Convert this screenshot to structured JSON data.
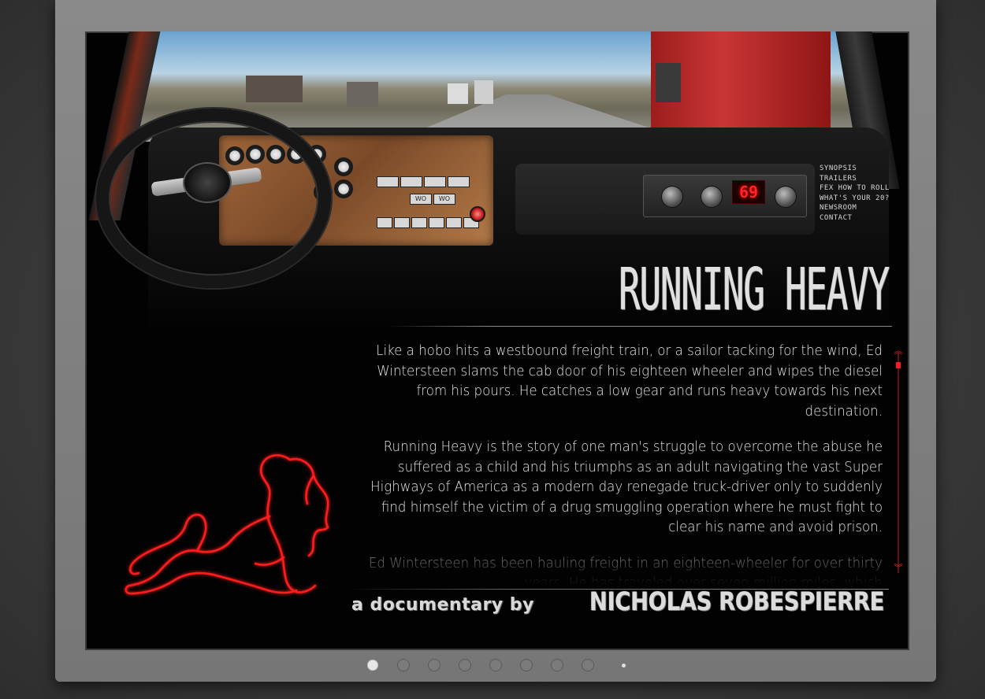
{
  "nav": {
    "items": [
      "SYNOPSIS",
      "TRAILERS",
      "FEX HOW TO ROLL",
      "WHAT'S YOUR 20?",
      "NEWSROOM",
      "CONTACT"
    ]
  },
  "header": {
    "title": "RUNNING HEAVY"
  },
  "synopsis": {
    "paragraphs": [
      "Like a hobo hits a westbound freight train, or a sailor tacking for the wind, Ed Wintersteen slams the cab door of his eighteen wheeler and wipes the diesel from his pours.  He catches a low gear and runs heavy towards his next destination.",
      "Running Heavy is the story of one man's struggle to overcome the abuse he suffered as a child and his triumphs as an adult navigating the vast Super Highways of America as a modern day renegade truck-driver only to suddenly find himself the victim of a drug smuggling operation where he must fight to clear his name and avoid prison.",
      "Ed Wintersteen has been hauling freight in an eighteen-wheeler for over thirty years. He has traveled over seven million miles, which"
    ]
  },
  "dashboard": {
    "radio_display": "69",
    "switch_labels": [
      "WO",
      "WO"
    ]
  },
  "credit": {
    "prefix": "a documentary by",
    "name": "NICHOLAS ROBESPIERRE"
  },
  "scroll": {
    "up_icon": "double-chevron-up-icon",
    "down_icon": "double-chevron-down-icon",
    "up_glyph": "︽",
    "down_glyph": "︾"
  },
  "pagination": {
    "total": 8,
    "active_index": 0
  },
  "colors": {
    "neon_red": "#ff1f1f",
    "screen_bg": "#020202",
    "bezel": "#7f7f7f"
  }
}
